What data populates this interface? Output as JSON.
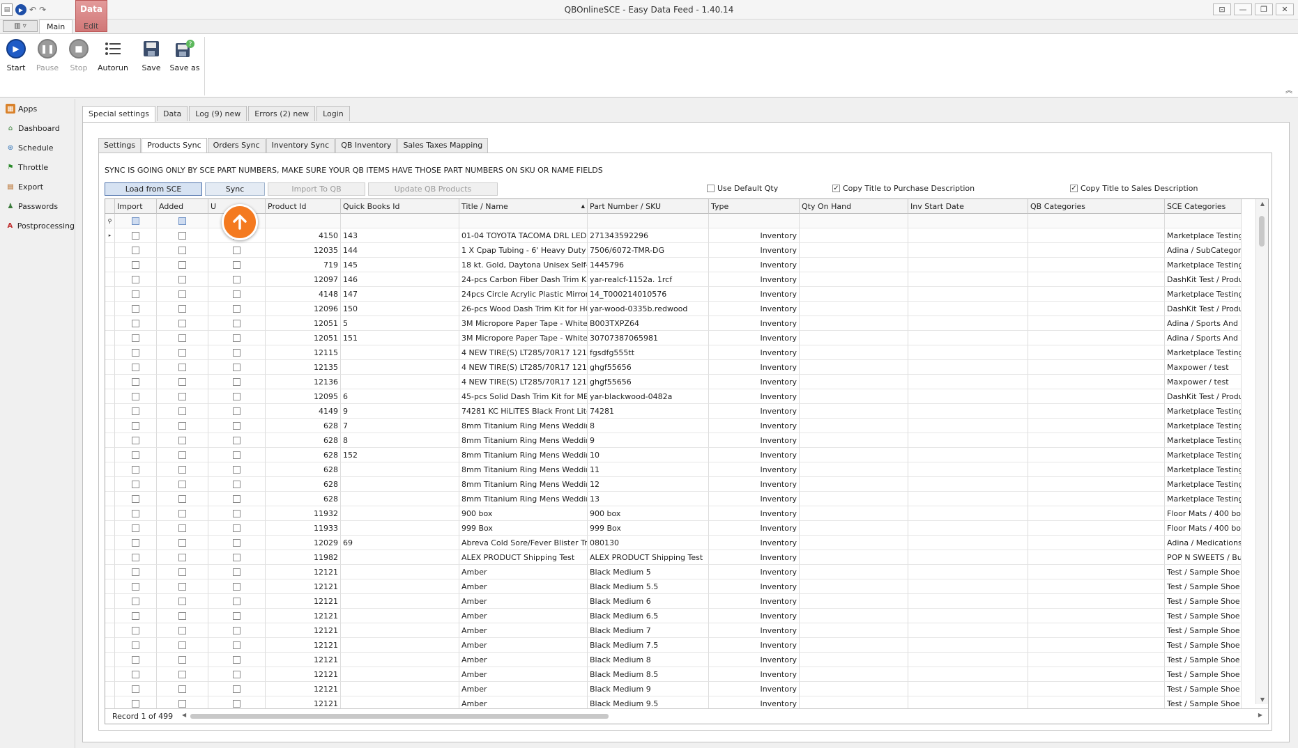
{
  "window": {
    "title": "QBOnlineSCE - Easy Data Feed - 1.40.14",
    "controls": [
      "⊡",
      "—",
      "❐",
      "✕"
    ]
  },
  "ribbon": {
    "context_tab": "Data",
    "tabs": [
      "Main",
      "Edit"
    ],
    "buttons": [
      {
        "label": "Start",
        "icon": "play-icon"
      },
      {
        "label": "Pause",
        "icon": "pause-icon"
      },
      {
        "label": "Stop",
        "icon": "stop-icon"
      },
      {
        "label": "Autorun",
        "icon": "autorun-icon"
      },
      {
        "label": "Save",
        "icon": "save-icon"
      },
      {
        "label": "Save as",
        "icon": "save-as-icon"
      }
    ]
  },
  "sidebar": {
    "items": [
      {
        "label": "Apps",
        "icon": "apps-icon"
      },
      {
        "label": "Dashboard",
        "icon": "dashboard-icon"
      },
      {
        "label": "Schedule",
        "icon": "schedule-icon"
      },
      {
        "label": "Throttle",
        "icon": "throttle-icon"
      },
      {
        "label": "Export",
        "icon": "export-icon"
      },
      {
        "label": "Passwords",
        "icon": "passwords-icon"
      },
      {
        "label": "Postprocessing",
        "icon": "postprocessing-icon"
      }
    ]
  },
  "main_tabs": [
    "Special settings",
    "Data",
    "Log (9) new",
    "Errors (2) new",
    "Login"
  ],
  "sub_tabs": [
    "Settings",
    "Products Sync",
    "Orders Sync",
    "Inventory Sync",
    "QB Inventory",
    "Sales Taxes Mapping"
  ],
  "products_sync": {
    "notice": "SYNC IS GOING ONLY BY SCE PART NUMBERS, MAKE SURE YOUR QB ITEMS HAVE THOSE PART NUMBERS ON SKU OR NAME FIELDS",
    "buttons": {
      "load": "Load from SCE",
      "sync": "Sync",
      "import": "Import To QB",
      "update": "Update QB Products"
    },
    "options": {
      "use_default_qty": "Use Default Qty",
      "copy_title_purchase": "Copy Title to Purchase Description",
      "copy_title_sales": "Copy Title to Sales Description"
    }
  },
  "grid": {
    "columns": [
      "Import",
      "Added",
      "U",
      "Product Id",
      "Quick Books Id",
      "Title / Name",
      "Part Number / SKU",
      "Type",
      "Qty On Hand",
      "Inv Start Date",
      "QB Categories",
      "SCE Categories"
    ],
    "sort_indicator": "▲",
    "current_row_indicator": "▸",
    "rows": [
      {
        "pid": "4150",
        "qbid": "143",
        "title": "01-04 TOYOTA TACOMA DRL LED ...",
        "sku": "271343592296",
        "type": "Inventory",
        "sce": "Marketplace Testing /"
      },
      {
        "pid": "12035",
        "qbid": "144",
        "title": "1 X Cpap Tubing - 6' Heavy Duty",
        "sku": "7506/6072-TMR-DG",
        "type": "Inventory",
        "sce": "Adina / SubCategory I"
      },
      {
        "pid": "719",
        "qbid": "145",
        "title": "18 kt. Gold, Daytona Unisex Self-...",
        "sku": "1445796",
        "type": "Inventory",
        "sce": "Marketplace Testing /"
      },
      {
        "pid": "12097",
        "qbid": "146",
        "title": "24-pcs Carbon Fiber Dash Trim Kit ...",
        "sku": "yar-realcf-1152a. 1rcf",
        "type": "Inventory",
        "sce": "DashKit Test / Produc"
      },
      {
        "pid": "4148",
        "qbid": "147",
        "title": "24pcs Circle Acrylic Plastic Mirror ...",
        "sku": "14_T000214010576",
        "type": "Inventory",
        "sce": "Marketplace Testing /"
      },
      {
        "pid": "12096",
        "qbid": "150",
        "title": "26-pcs Wood Dash Trim Kit for HO...",
        "sku": "yar-wood-0335b.redwood",
        "type": "Inventory",
        "sce": "DashKit Test / Produc"
      },
      {
        "pid": "12051",
        "qbid": "5",
        "title": "3M Micropore Paper Tape - White,...",
        "sku": "B003TXPZ64",
        "type": "Inventory",
        "sce": "Adina / Sports And Ou"
      },
      {
        "pid": "12051",
        "qbid": "151",
        "title": "3M Micropore Paper Tape - White,...",
        "sku": "30707387065981",
        "type": "Inventory",
        "sce": "Adina / Sports And Ou"
      },
      {
        "pid": "12115",
        "qbid": "",
        "title": "4 NEW TIRE(S) LT285/70R17 121/...",
        "sku": "fgsdfg555tt",
        "type": "Inventory",
        "sce": "Marketplace Testing /"
      },
      {
        "pid": "12135",
        "qbid": "",
        "title": "4 NEW TIRE(S) LT285/70R17 121/...",
        "sku": "ghgf55656",
        "type": "Inventory",
        "sce": "Maxpower / test"
      },
      {
        "pid": "12136",
        "qbid": "",
        "title": "4 NEW TIRE(S) LT285/70R17 121/...",
        "sku": "ghgf55656",
        "type": "Inventory",
        "sce": "Maxpower / test"
      },
      {
        "pid": "12095",
        "qbid": "6",
        "title": "45-pcs Solid Dash Trim Kit for MER...",
        "sku": "yar-blackwood-0482a",
        "type": "Inventory",
        "sce": "DashKit Test / Produc"
      },
      {
        "pid": "4149",
        "qbid": "9",
        "title": "74281 KC HiLiTES Black Front Lite ...",
        "sku": "74281",
        "type": "Inventory",
        "sce": "Marketplace Testing /"
      },
      {
        "pid": "628",
        "qbid": "7",
        "title": "8mm Titanium Ring Mens Wedding ...",
        "sku": "8",
        "type": "Inventory",
        "sce": "Marketplace Testing /"
      },
      {
        "pid": "628",
        "qbid": "8",
        "title": "8mm Titanium Ring Mens Wedding ...",
        "sku": "9",
        "type": "Inventory",
        "sce": "Marketplace Testing /"
      },
      {
        "pid": "628",
        "qbid": "152",
        "title": "8mm Titanium Ring Mens Wedding ...",
        "sku": "10",
        "type": "Inventory",
        "sce": "Marketplace Testing /"
      },
      {
        "pid": "628",
        "qbid": "",
        "title": "8mm Titanium Ring Mens Wedding ...",
        "sku": "11",
        "type": "Inventory",
        "sce": "Marketplace Testing /"
      },
      {
        "pid": "628",
        "qbid": "",
        "title": "8mm Titanium Ring Mens Wedding ...",
        "sku": "12",
        "type": "Inventory",
        "sce": "Marketplace Testing /"
      },
      {
        "pid": "628",
        "qbid": "",
        "title": "8mm Titanium Ring Mens Wedding ...",
        "sku": "13",
        "type": "Inventory",
        "sce": "Marketplace Testing /"
      },
      {
        "pid": "11932",
        "qbid": "",
        "title": "900 box",
        "sku": "900 box",
        "type": "Inventory",
        "sce": "Floor Mats / 400 box"
      },
      {
        "pid": "11933",
        "qbid": "",
        "title": "999 Box",
        "sku": "999 Box",
        "type": "Inventory",
        "sce": "Floor Mats / 400 box"
      },
      {
        "pid": "12029",
        "qbid": "69",
        "title": "Abreva Cold Sore/Fever Blister Tr...",
        "sku": "080130",
        "type": "Inventory",
        "sce": "Adina / Medications Ar"
      },
      {
        "pid": "11982",
        "qbid": "",
        "title": "ALEX PRODUCT Shipping Test",
        "sku": "ALEX PRODUCT Shipping Test",
        "type": "Inventory",
        "sce": "POP N SWEETS / Bunc"
      },
      {
        "pid": "12121",
        "qbid": "",
        "title": "Amber",
        "sku": "Black Medium 5",
        "type": "Inventory",
        "sce": "Test / Sample Shoe"
      },
      {
        "pid": "12121",
        "qbid": "",
        "title": "Amber",
        "sku": "Black Medium 5.5",
        "type": "Inventory",
        "sce": "Test / Sample Shoe"
      },
      {
        "pid": "12121",
        "qbid": "",
        "title": "Amber",
        "sku": "Black Medium 6",
        "type": "Inventory",
        "sce": "Test / Sample Shoe"
      },
      {
        "pid": "12121",
        "qbid": "",
        "title": "Amber",
        "sku": "Black Medium 6.5",
        "type": "Inventory",
        "sce": "Test / Sample Shoe"
      },
      {
        "pid": "12121",
        "qbid": "",
        "title": "Amber",
        "sku": "Black Medium 7",
        "type": "Inventory",
        "sce": "Test / Sample Shoe"
      },
      {
        "pid": "12121",
        "qbid": "",
        "title": "Amber",
        "sku": "Black Medium 7.5",
        "type": "Inventory",
        "sce": "Test / Sample Shoe"
      },
      {
        "pid": "12121",
        "qbid": "",
        "title": "Amber",
        "sku": "Black Medium 8",
        "type": "Inventory",
        "sce": "Test / Sample Shoe"
      },
      {
        "pid": "12121",
        "qbid": "",
        "title": "Amber",
        "sku": "Black Medium 8.5",
        "type": "Inventory",
        "sce": "Test / Sample Shoe"
      },
      {
        "pid": "12121",
        "qbid": "",
        "title": "Amber",
        "sku": "Black Medium 9",
        "type": "Inventory",
        "sce": "Test / Sample Shoe"
      },
      {
        "pid": "12121",
        "qbid": "",
        "title": "Amber",
        "sku": "Black Medium 9.5",
        "type": "Inventory",
        "sce": "Test / Sample Shoe"
      }
    ],
    "status": "Record 1 of 499"
  }
}
